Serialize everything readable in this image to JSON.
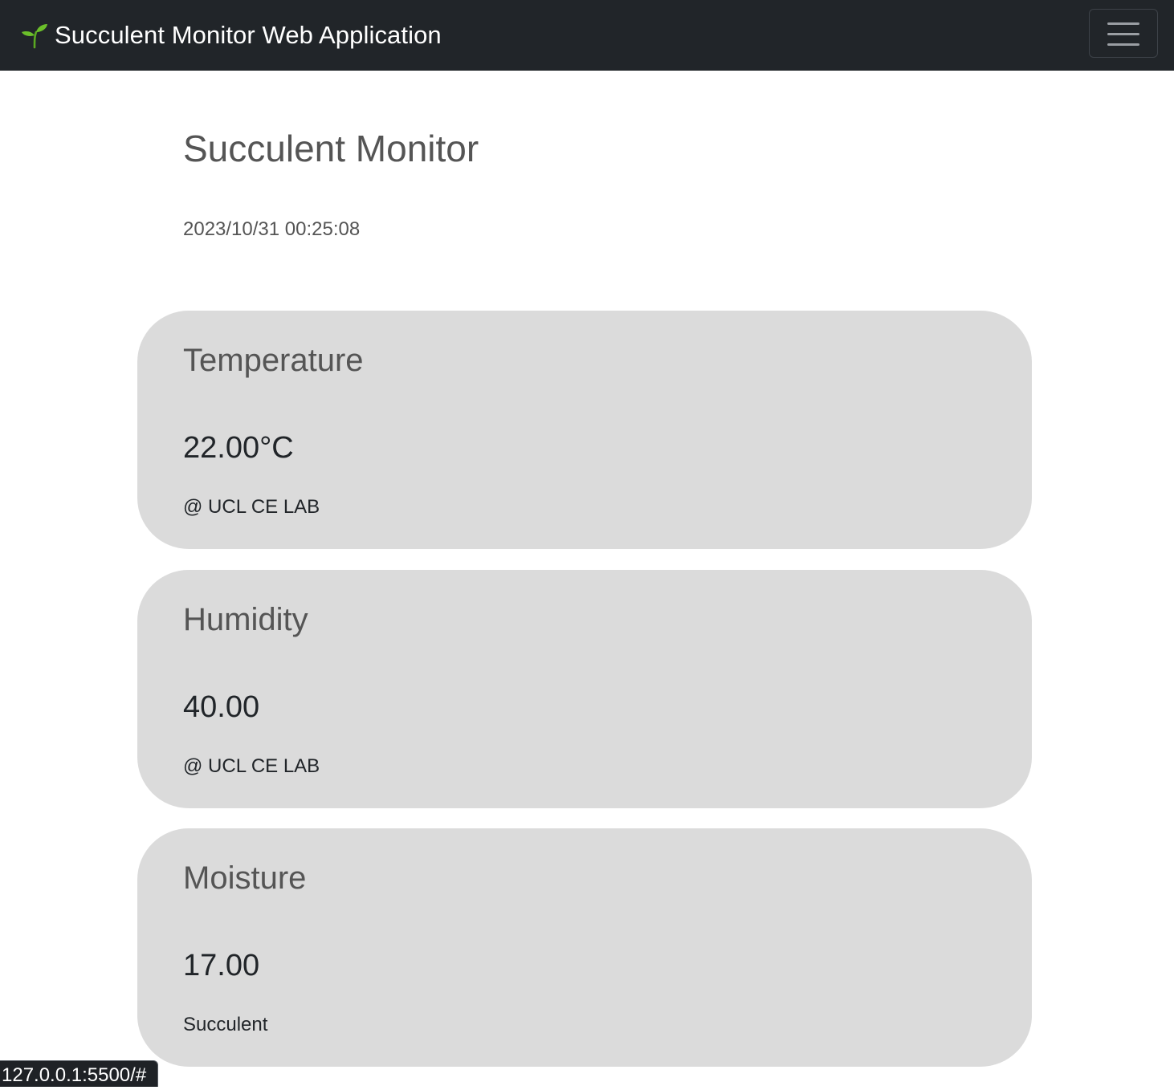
{
  "navbar": {
    "brand_icon": "seedling-icon",
    "brand_text": "Succulent Monitor Web Application",
    "toggler_icon": "hamburger-menu-icon"
  },
  "main": {
    "title": "Succulent Monitor",
    "timestamp": "2023/10/31 00:25:08",
    "cards": [
      {
        "title": "Temperature",
        "value": "22.00°C",
        "subtitle": "@ UCL CE LAB"
      },
      {
        "title": "Humidity",
        "value": "40.00",
        "subtitle": "@ UCL CE LAB"
      },
      {
        "title": "Moisture",
        "value": "17.00",
        "subtitle": "Succulent"
      }
    ]
  },
  "status_bar": {
    "url": "127.0.0.1:5500/#"
  },
  "colors": {
    "navbar_bg": "#212529",
    "card_bg": "#dbdbdb",
    "leaf_green": "#6bbf2a"
  }
}
